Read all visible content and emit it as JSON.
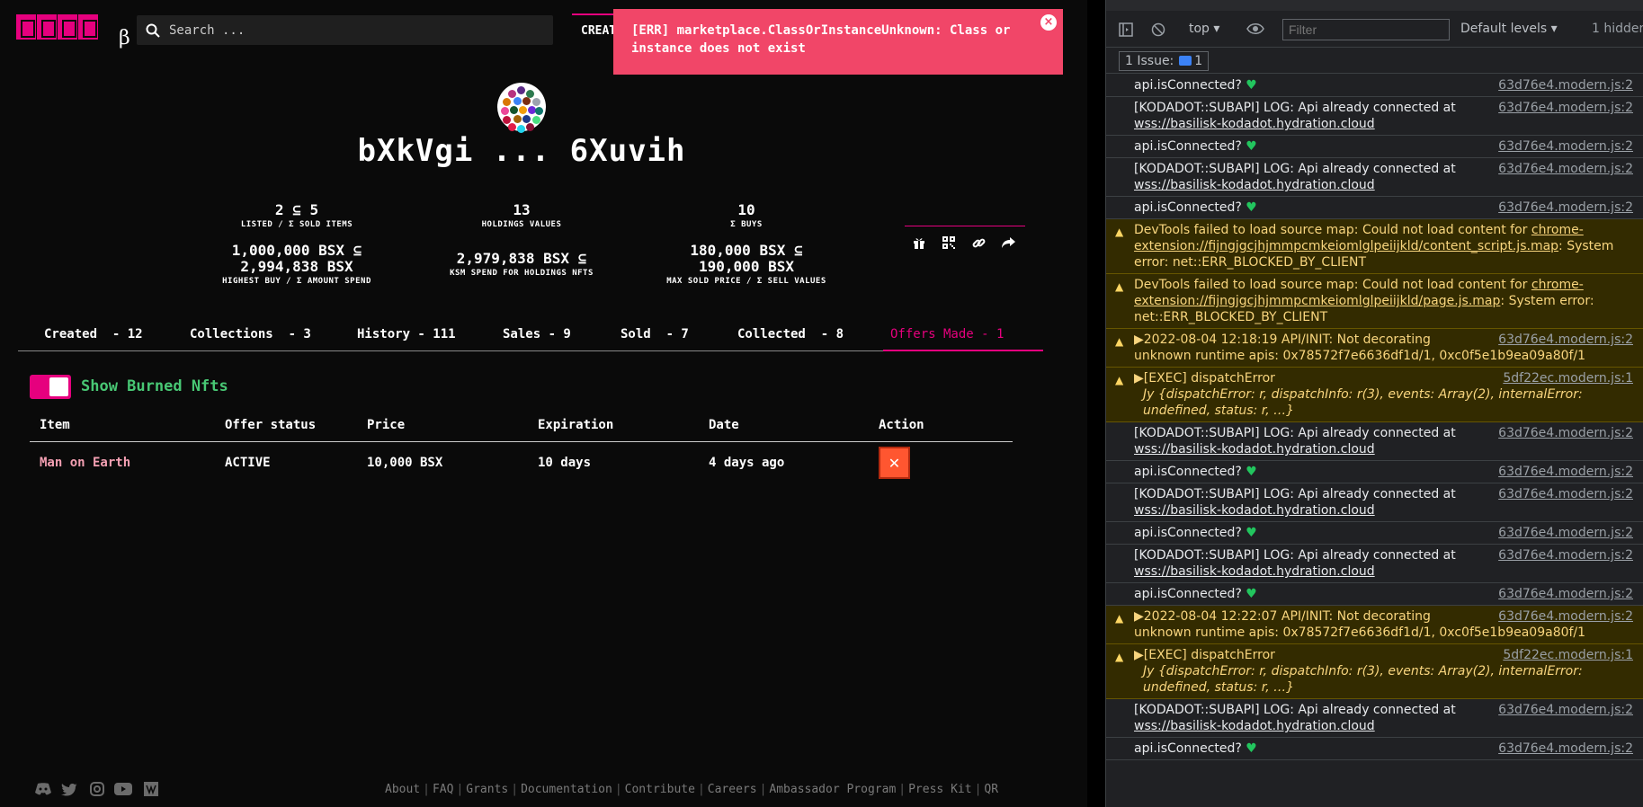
{
  "app": {
    "search_placeholder": "Search ...",
    "nav_create": "CREATE",
    "toast_message": "[ERR] marketplace.ClassOrInstanceUnknown: Class or instance does not exist",
    "toast_close": "×",
    "profile_name": "bXkVgi ... 6Xuvih",
    "stats": [
      {
        "value": "2 ⊆ 5",
        "label": "LISTED / Σ SOLD ITEMS"
      },
      {
        "value": "13",
        "label": "HOLDINGS VALUES"
      },
      {
        "value": "10",
        "label": "Σ BUYS"
      },
      {
        "value1": "1,000,000 BSX ⊆",
        "value2": "2,994,838 BSX",
        "label": "HIGHEST BUY / Σ AMOUNT SPEND"
      },
      {
        "value1": "2,979,838 BSX ⊆",
        "label": "KSM SPEND FOR HOLDINGS NFTS"
      },
      {
        "value1": "180,000 BSX ⊆",
        "value2": "190,000 BSX",
        "label": "MAX SOLD PRICE / Σ SELL VALUES"
      }
    ],
    "tabs": [
      "Created  - 12",
      "Collections  - 3",
      "History - 111",
      "Sales - 9",
      "Sold  - 7",
      "Collected  - 8",
      "Offers Made - 1"
    ],
    "toggle_label": "Show Burned Nfts",
    "table": {
      "headers": [
        "Item",
        "Offer status",
        "Price",
        "Expiration",
        "Date",
        "Action"
      ],
      "row": {
        "item": "Man on Earth",
        "status": "ACTIVE",
        "price": "10,000 BSX",
        "expiration": "10 days",
        "date": "4 days ago",
        "action": "✕"
      }
    },
    "footer_links": [
      "About",
      "FAQ",
      "Grants",
      "Documentation",
      "Contribute",
      "Careers",
      "Ambassador Program",
      "Press Kit",
      "QR"
    ],
    "accent": "#e6007e"
  },
  "devtools": {
    "context": "top",
    "filter_placeholder": "Filter",
    "levels": "Default levels",
    "hidden": "1 hidden",
    "issues": "1 Issue:",
    "issues_count": "1",
    "logs": [
      {
        "type": "log",
        "msg": "api.isConnected? ",
        "heart": true,
        "src": "63d76e4.modern.js:2"
      },
      {
        "type": "log",
        "msg": "[KODADOT::SUBAPI] LOG: Api already connected at ",
        "link": "wss://basilisk-kodadot.hydration.cloud",
        "src": "63d76e4.modern.js:2"
      },
      {
        "type": "log",
        "msg": "api.isConnected? ",
        "heart": true,
        "src": "63d76e4.modern.js:2"
      },
      {
        "type": "log",
        "msg": "[KODADOT::SUBAPI] LOG: Api already connected at ",
        "link": "wss://basilisk-kodadot.hydration.cloud",
        "src": "63d76e4.modern.js:2"
      },
      {
        "type": "log",
        "msg": "api.isConnected? ",
        "heart": true,
        "src": "63d76e4.modern.js:2"
      },
      {
        "type": "warn",
        "msg": "DevTools failed to load source map: Could not load content for ",
        "link": "chrome-extension://fijngjgcjhjmmpcmkeiomlglpeiijkld/content_script.js.map",
        "tail": ": System error: net::ERR_BLOCKED_BY_CLIENT"
      },
      {
        "type": "warn",
        "msg": "DevTools failed to load source map: Could not load content for ",
        "link": "chrome-extension://fijngjgcjhjmmpcmkeiomlglpeiijkld/page.js.map",
        "tail": ": System error: net::ERR_BLOCKED_BY_CLIENT"
      },
      {
        "type": "warn",
        "msg": "▶2022-08-04 12:18:19        API/INIT: Not decorating unknown runtime apis: 0x78572f7e6636df1d/1, 0xc0f5e1b9ea09a80f/1",
        "src": "63d76e4.modern.js:2"
      },
      {
        "type": "warn",
        "msg": "▶[EXEC] dispatchError",
        "detail": "Jy {dispatchError: r, dispatchInfo: r(3), events: Array(2), internalError: undefined, status: r, …}",
        "src": "5df22ec.modern.js:1"
      },
      {
        "type": "log",
        "msg": "[KODADOT::SUBAPI] LOG: Api already connected at ",
        "link": "wss://basilisk-kodadot.hydration.cloud",
        "src": "63d76e4.modern.js:2"
      },
      {
        "type": "log",
        "msg": "api.isConnected? ",
        "heart": true,
        "src": "63d76e4.modern.js:2"
      },
      {
        "type": "log",
        "msg": "[KODADOT::SUBAPI] LOG: Api already connected at ",
        "link": "wss://basilisk-kodadot.hydration.cloud",
        "src": "63d76e4.modern.js:2"
      },
      {
        "type": "log",
        "msg": "api.isConnected? ",
        "heart": true,
        "src": "63d76e4.modern.js:2"
      },
      {
        "type": "log",
        "msg": "[KODADOT::SUBAPI] LOG: Api already connected at ",
        "link": "wss://basilisk-kodadot.hydration.cloud",
        "src": "63d76e4.modern.js:2"
      },
      {
        "type": "log",
        "msg": "api.isConnected? ",
        "heart": true,
        "src": "63d76e4.modern.js:2"
      },
      {
        "type": "warn",
        "msg": "▶2022-08-04 12:22:07        API/INIT: Not decorating unknown runtime apis: 0x78572f7e6636df1d/1, 0xc0f5e1b9ea09a80f/1",
        "src": "63d76e4.modern.js:2"
      },
      {
        "type": "warn",
        "msg": "▶[EXEC] dispatchError",
        "detail": "Jy {dispatchError: r, dispatchInfo: r(3), events: Array(2), internalError: undefined, status: r, …}",
        "src": "5df22ec.modern.js:1"
      },
      {
        "type": "log",
        "msg": "[KODADOT::SUBAPI] LOG: Api already connected at ",
        "link": "wss://basilisk-kodadot.hydration.cloud",
        "src": "63d76e4.modern.js:2"
      },
      {
        "type": "log",
        "msg": "api.isConnected? ",
        "heart": true,
        "src": "63d76e4.modern.js:2"
      }
    ]
  }
}
